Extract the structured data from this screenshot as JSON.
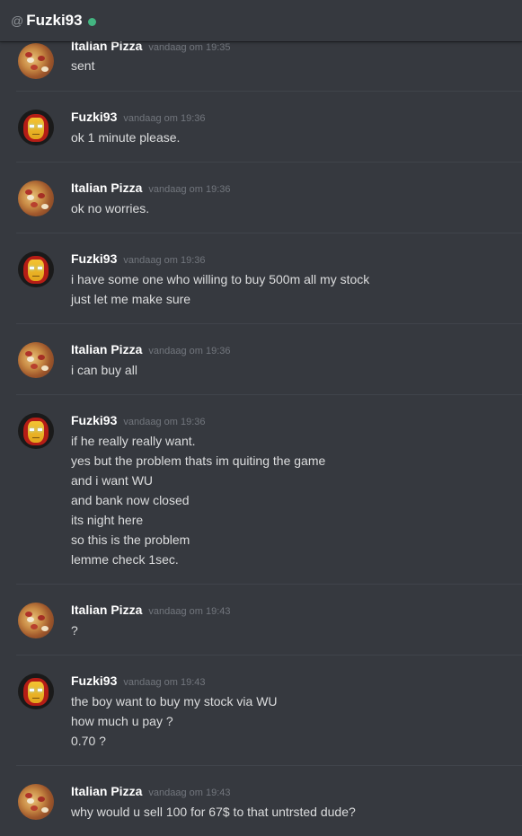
{
  "header": {
    "at_symbol": "@",
    "username": "Fuzki93",
    "status_color": "#43b581"
  },
  "messages": [
    {
      "author": "Italian Pizza",
      "avatar": "pizza-avatar",
      "timestamp": "vandaag om 19:35",
      "lines": [
        "sent"
      ]
    },
    {
      "author": "Fuzki93",
      "avatar": "ironman-avatar",
      "timestamp": "vandaag om 19:36",
      "lines": [
        "ok 1 minute please."
      ]
    },
    {
      "author": "Italian Pizza",
      "avatar": "pizza-avatar",
      "timestamp": "vandaag om 19:36",
      "lines": [
        "ok no worries."
      ]
    },
    {
      "author": "Fuzki93",
      "avatar": "ironman-avatar",
      "timestamp": "vandaag om 19:36",
      "lines": [
        "i have some one who willing to buy 500m all my stock",
        "just let me make sure"
      ]
    },
    {
      "author": "Italian Pizza",
      "avatar": "pizza-avatar",
      "timestamp": "vandaag om 19:36",
      "lines": [
        "i can buy all"
      ]
    },
    {
      "author": "Fuzki93",
      "avatar": "ironman-avatar",
      "timestamp": "vandaag om 19:36",
      "lines": [
        "if he really really want.",
        "yes but the problem thats im quiting the game",
        "and i want WU",
        "and bank now closed",
        "its night here",
        "so this is the problem",
        "lemme check 1sec."
      ]
    },
    {
      "author": "Italian Pizza",
      "avatar": "pizza-avatar",
      "timestamp": "vandaag om 19:43",
      "lines": [
        "?"
      ]
    },
    {
      "author": "Fuzki93",
      "avatar": "ironman-avatar",
      "timestamp": "vandaag om 19:43",
      "lines": [
        "the boy want to buy my stock via WU",
        "how much u pay ?",
        "0.70 ?"
      ]
    },
    {
      "author": "Italian Pizza",
      "avatar": "pizza-avatar",
      "timestamp": "vandaag om 19:43",
      "lines": [
        "why would u sell 100 for 67$ to that untrsted dude?"
      ]
    }
  ]
}
